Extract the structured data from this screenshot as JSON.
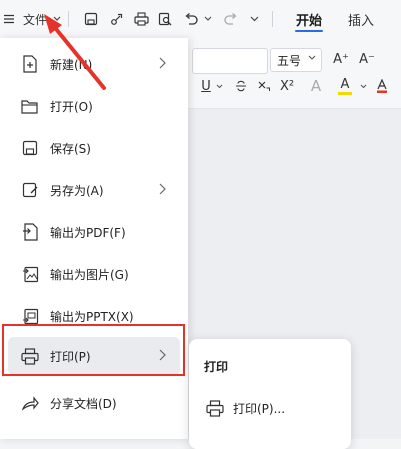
{
  "toolbar": {
    "menu_label": "文件",
    "tab_home": "开始",
    "tab_insert": "插入"
  },
  "ribbon": {
    "font_size": "五号",
    "grow_font": "A⁺",
    "shrink_font": "A⁻",
    "underline": "U",
    "superscript": "X²",
    "font_effect": "A",
    "highlight": "A"
  },
  "file_menu": {
    "items": [
      {
        "label": "新建(N)",
        "icon": "new-doc-icon",
        "has_submenu": true
      },
      {
        "label": "打开(O)",
        "icon": "folder-open-icon",
        "has_submenu": false
      },
      {
        "label": "保存(S)",
        "icon": "save-icon",
        "has_submenu": false
      },
      {
        "label": "另存为(A)",
        "icon": "save-as-icon",
        "has_submenu": true
      },
      {
        "label": "输出为PDF(F)",
        "icon": "export-pdf-icon",
        "has_submenu": false
      },
      {
        "label": "输出为图片(G)",
        "icon": "export-image-icon",
        "has_submenu": false
      },
      {
        "label": "输出为PPTX(X)",
        "icon": "export-pptx-icon",
        "has_submenu": false
      },
      {
        "label": "打印(P)",
        "icon": "printer-icon",
        "has_submenu": true
      },
      {
        "label": "分享文档(D)",
        "icon": "share-icon",
        "has_submenu": false
      }
    ]
  },
  "print_submenu": {
    "title": "打印",
    "items": [
      {
        "label": "打印(P)...",
        "icon": "printer-icon"
      }
    ]
  },
  "colors": {
    "accent": "#2b6be9",
    "annotation_red": "#e5332a",
    "highlight_yellow": "#f5d800"
  }
}
